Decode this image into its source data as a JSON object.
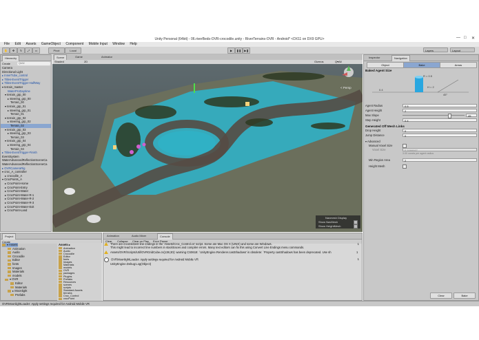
{
  "window": {
    "title": "Unity Personal (64bit) - 06.riverBeds-OVR-crocodile.unity - RiverTerrains-OVR - Android* <DX11 on DX9 GPU>",
    "controls": [
      "—",
      "□",
      "✕"
    ]
  },
  "menu": [
    "File",
    "Edit",
    "Assets",
    "GameObject",
    "Component",
    "Mobile Input",
    "Window",
    "Help"
  ],
  "toolbar": {
    "pivot": "Pivot",
    "local": "Local",
    "layers": "Layers",
    "layout": "Layout"
  },
  "hierarchy": {
    "tab": "Hierarchy",
    "create": "Create",
    "search_placeholder": "Q▾All",
    "items": [
      {
        "label": "Camera",
        "blue": false,
        "indent": 0
      },
      {
        "label": "Directional Light",
        "blue": false,
        "indent": 0
      },
      {
        "label": "▸ InnerTube_control",
        "blue": true,
        "indent": 0
      },
      {
        "label": "▸ Titles-EventTrigger",
        "blue": true,
        "indent": 0
      },
      {
        "label": "▸ Titles-EventTrigger-HalfWay",
        "blue": true,
        "indent": 0
      },
      {
        "label": "▾ terrain_master",
        "blue": false,
        "indent": 0
      },
      {
        "label": "WaterProDaytime",
        "blue": true,
        "indent": 2
      },
      {
        "label": "▾ terrain_grp_00",
        "blue": false,
        "indent": 1
      },
      {
        "label": "▸ steering_grp_00",
        "blue": false,
        "indent": 2
      },
      {
        "label": "Terrain_00",
        "blue": false,
        "indent": 3
      },
      {
        "label": "▾ terrain_grp_01",
        "blue": false,
        "indent": 1
      },
      {
        "label": "▸ steering_grp_01",
        "blue": false,
        "indent": 2
      },
      {
        "label": "Terrain_01",
        "blue": false,
        "indent": 3
      },
      {
        "label": "▾ terrain_grp_02",
        "blue": false,
        "indent": 1
      },
      {
        "label": "▸ steering_grp_02",
        "blue": false,
        "indent": 2
      },
      {
        "label": "Terrain_02",
        "blue": false,
        "indent": 3,
        "selected": true
      },
      {
        "label": "▾ terrain_grp_03",
        "blue": false,
        "indent": 1
      },
      {
        "label": "▸ steering_grp_03",
        "blue": false,
        "indent": 2
      },
      {
        "label": "Terrain_03",
        "blue": false,
        "indent": 3
      },
      {
        "label": "▾ terrain_grp_04",
        "blue": false,
        "indent": 1
      },
      {
        "label": "▸ steering_grp_04",
        "blue": false,
        "indent": 2
      },
      {
        "label": "Terrain_04",
        "blue": false,
        "indent": 3
      },
      {
        "label": "▸ Titles-EventTrigger-Finish",
        "blue": true,
        "indent": 0
      },
      {
        "label": "EventSystem",
        "blue": false,
        "indent": 0
      },
      {
        "label": "WaterAdvancedReflectionSceneCa",
        "blue": false,
        "indent": 0
      },
      {
        "label": "WaterAdvancedReflectionSceneCa",
        "blue": false,
        "indent": 0
      },
      {
        "label": "▸ OVRCameraRig",
        "blue": true,
        "indent": 0
      },
      {
        "label": "▾ croc_A_controller",
        "blue": false,
        "indent": 0
      },
      {
        "label": "▸ crocodile_A",
        "blue": false,
        "indent": 1
      },
      {
        "label": "▾ CrocPoints_A",
        "blue": false,
        "indent": 0
      },
      {
        "label": "▸ CrocPoint-Home",
        "blue": false,
        "indent": 1
      },
      {
        "label": "▸ CrocPoint-Entry",
        "blue": false,
        "indent": 1
      },
      {
        "label": "▸ CrocPoint-Water",
        "blue": false,
        "indent": 1
      },
      {
        "label": "▸ CrocPoint-Water-R-1",
        "blue": false,
        "indent": 1
      },
      {
        "label": "▸ CrocPoint-Water-R-2",
        "blue": false,
        "indent": 1
      },
      {
        "label": "▸ CrocPoint-Water-R-3",
        "blue": false,
        "indent": 1
      },
      {
        "label": "▸ CrocPoint-Water-Exit",
        "blue": false,
        "indent": 1
      },
      {
        "label": "▸ CrocPoint-Land",
        "blue": false,
        "indent": 1
      }
    ]
  },
  "scene": {
    "tabs": [
      "Scene",
      "Game",
      "Animator"
    ],
    "shading": "Shaded",
    "mode": "2D",
    "gizmos": "Gizmos",
    "all": "Q▾All",
    "persp": "< Persp",
    "navmesh_overlay": {
      "title": "Navmesh Display",
      "show_navmesh": "Show NavMesh",
      "show_heightmesh": "Show HeightMesh"
    }
  },
  "inspector": {
    "tabs": [
      "Inspector",
      "Navigation"
    ],
    "subtabs": [
      "Object",
      "Bake",
      "Areas"
    ],
    "baked_agent_size": "Baked Agent Size",
    "diagram": {
      "r": "R = 0.5",
      "h": "H = 2",
      "left": "0.4",
      "angle": "45°"
    },
    "fields": [
      {
        "label": "Agent Radius",
        "value": "0.5"
      },
      {
        "label": "Agent Height",
        "value": "2"
      },
      {
        "label": "Max Slope",
        "value": "45"
      },
      {
        "label": "Step Height",
        "value": "0.4"
      }
    ],
    "offmesh_title": "Generated Off Mesh Links",
    "offmesh_fields": [
      {
        "label": "Drop Height",
        "value": "0"
      },
      {
        "label": "Jump Distance",
        "value": "0"
      }
    ],
    "advanced": "▾ Advanced",
    "manual_voxel": "Manual Voxel Size",
    "voxel_size_label": "Voxel Size",
    "voxel_size_value": "0.1666667",
    "voxel_note": "3.00 voxels per agent radius",
    "min_region": {
      "label": "Min Region Area",
      "value": "2"
    },
    "height_mesh": "Height Mesh",
    "clear": "Clear",
    "bake": "Bake"
  },
  "project": {
    "tab": "Project",
    "create": "Create",
    "tree": [
      {
        "label": "▾ Assets",
        "indent": 0,
        "selected": true
      },
      {
        "label": "Animation",
        "indent": 2
      },
      {
        "label": "Audio",
        "indent": 2
      },
      {
        "label": "Crocodile",
        "indent": 2
      },
      {
        "label": "Editor",
        "indent": 2
      },
      {
        "label": "fonts",
        "indent": 2
      },
      {
        "label": "Images",
        "indent": 2
      },
      {
        "label": "Materials",
        "indent": 2
      },
      {
        "label": "models",
        "indent": 2
      },
      {
        "label": "▾ OVR",
        "indent": 1
      },
      {
        "label": "Editor",
        "indent": 3
      },
      {
        "label": "Materials",
        "indent": 3
      },
      {
        "label": "▸ Moonlight",
        "indent": 2
      },
      {
        "label": "Prefabs",
        "indent": 3
      }
    ],
    "assets_header": "Assets ▸",
    "assets": [
      "Animation",
      "Audio",
      "Crocodile",
      "Editor",
      "fonts",
      "Images",
      "Materials",
      "models",
      "OVR",
      "packages",
      "Plugins",
      "Prefabs",
      "Resources",
      "scenes",
      "scripts",
      "Standard Assets",
      "terrains",
      "Croc_Control",
      "crocPoint"
    ]
  },
  "console": {
    "tabs": [
      "Animation",
      "Audio Mixer",
      "Console"
    ],
    "buttons": [
      "Clear",
      "Collapse",
      "Clear on Play",
      "Error Pause"
    ],
    "messages": [
      {
        "type": "warn",
        "line1": "There are inconsistent line endings in the 'Assets/Croc_Control.cs' script. Some are Mac OS X (UNIX) and some are Windows.",
        "line2": "This might lead to incorrect line numbers in stacktraces and compiler errors. Many text editors can fix this using Convert Line Endings menu commands.",
        "count": "1"
      },
      {
        "type": "warn",
        "line1": "Assets/OVR/Scripts/Util/OVRGridCube.cs(138,30): warning CS0618: `UnityEngine.Renderer.castShadows' is obsolete: `Property castShadows has been deprecated. Use sh",
        "line2": "",
        "count": "1"
      },
      {
        "type": "info",
        "line1": "OVRMoonlightLoader: Apply settings required for Android Mobile VR",
        "line2": "UnityEngine.Debug:Log(Object)",
        "count": "1"
      }
    ]
  },
  "status_bar": "OVRMoonlightLoader: Apply settings required for Android Mobile VR",
  "colors": {
    "navmesh": "#2fb3c8",
    "selection": "#8aa6d0",
    "link_blue": "#1c4fa8"
  }
}
